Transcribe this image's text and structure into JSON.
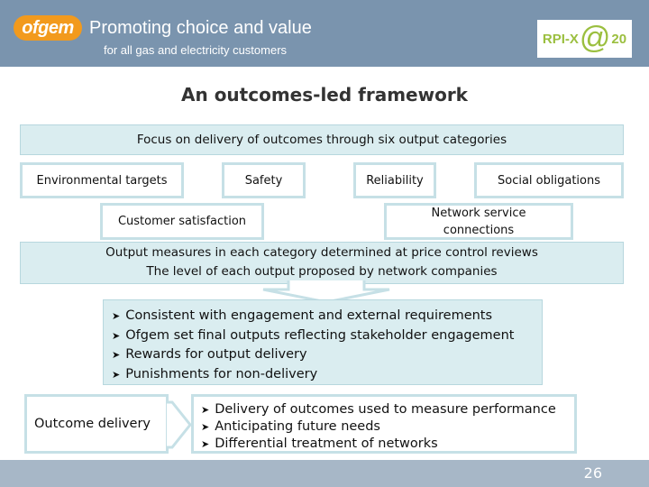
{
  "header": {
    "logo_text": "ofgem",
    "tagline": "Promoting choice and value",
    "subtagline": "for all gas and electricity customers",
    "badge": {
      "left": "RPI-X",
      "at": "@",
      "right": "20"
    }
  },
  "slide": {
    "title": "An outcomes-led framework",
    "focus_band": "Focus on delivery of outcomes through six output categories",
    "categories": [
      "Environmental targets",
      "Safety",
      "Reliability",
      "Social obligations",
      "Customer satisfaction",
      "Network service connections"
    ],
    "measures_band": {
      "line1": "Output measures in each category determined at price control reviews",
      "line2": "The level of each output proposed by network companies"
    },
    "bullets": [
      "Consistent with engagement and external requirements",
      "Ofgem set final outputs reflecting stakeholder engagement",
      "Rewards for output delivery",
      "Punishments for non-delivery"
    ],
    "outcome_label": "Outcome delivery",
    "outcome_bullets": [
      "Delivery of outcomes used to measure performance",
      "Anticipating future needs",
      "Differential treatment of networks"
    ],
    "bullet_glyph": "➤"
  },
  "footer": {
    "page_number": "26"
  },
  "colors": {
    "header_bg": "#7a94ae",
    "logo_orange": "#f29a1d",
    "badge_green": "#9bbf3f",
    "band_fill": "#daedf0",
    "box_border": "#c6e0e6",
    "footer_bg": "#a7b7c7"
  }
}
